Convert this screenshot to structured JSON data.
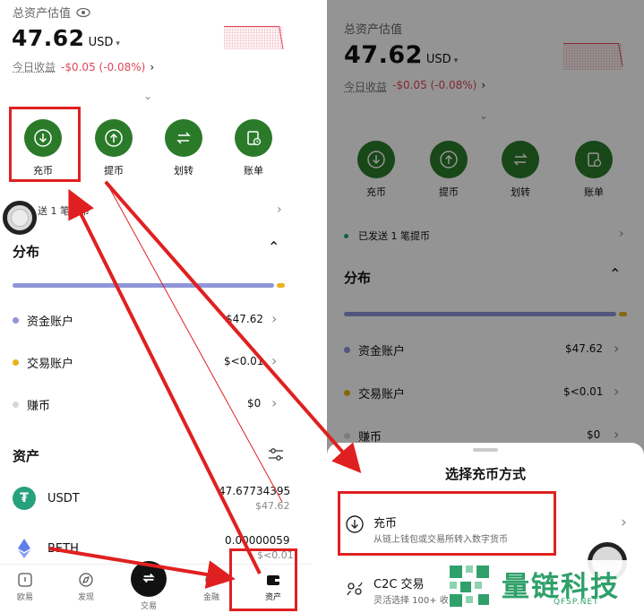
{
  "left": {
    "asset_title": "总资产估值",
    "balance": "47.62",
    "currency": "USD",
    "today_label": "今日收益",
    "today_value": "-$0.05 (-0.08%)",
    "actions": [
      {
        "label": "充币",
        "icon": "download-circle-icon"
      },
      {
        "label": "提币",
        "icon": "upload-circle-icon"
      },
      {
        "label": "划转",
        "icon": "transfer-arrows-icon"
      },
      {
        "label": "账单",
        "icon": "bill-clock-icon"
      }
    ],
    "notice": "已发送 1 笔提币",
    "notice_visible": "送 1 笔提币",
    "distribution_title": "分布",
    "accounts": [
      {
        "name": "资金账户",
        "value": "$47.62",
        "color": "#8e95d8"
      },
      {
        "name": "交易账户",
        "value": "$<0.01",
        "color": "#e8b21a"
      },
      {
        "name": "赚币",
        "value": "$0",
        "color": "#d8d8d8"
      }
    ],
    "assets_title": "资产",
    "assets": [
      {
        "symbol": "USDT",
        "amount": "47.67734395",
        "usd": "$47.62"
      },
      {
        "symbol": "BETH",
        "amount": "0.00000059",
        "usd": "$<0.01"
      }
    ],
    "nav": [
      {
        "label": "欧易",
        "icon": "home-icon"
      },
      {
        "label": "发现",
        "icon": "discover-icon"
      },
      {
        "label": "交易",
        "icon": "trade-icon"
      },
      {
        "label": "金融",
        "icon": "finance-icon"
      },
      {
        "label": "资产",
        "icon": "wallet-icon"
      }
    ]
  },
  "right": {
    "asset_title": "总资产估值",
    "balance": "47.62",
    "currency": "USD",
    "today_label": "今日收益",
    "today_value": "-$0.05 (-0.08%)",
    "actions": [
      {
        "label": "充币"
      },
      {
        "label": "提币"
      },
      {
        "label": "划转"
      },
      {
        "label": "账单"
      }
    ],
    "notice": "已发送 1 笔提币",
    "distribution_title": "分布",
    "accounts": [
      {
        "name": "资金账户",
        "value": "$47.62"
      },
      {
        "name": "交易账户",
        "value": "$<0.01"
      },
      {
        "name": "赚币",
        "value": "$0"
      }
    ],
    "sheet": {
      "title": "选择充币方式",
      "options": [
        {
          "title": "充币",
          "desc": "从链上钱包或交易所转入数字货币"
        },
        {
          "title": "C2C 交易",
          "desc": "灵活选择 100+ 收"
        }
      ]
    }
  },
  "watermark": {
    "name": "量链科技",
    "domain": "QFSP.NET"
  },
  "colors": {
    "accent_green": "#2a7a2a",
    "negative": "#e0475a",
    "highlight": "#e02020",
    "brand": "#2fa06a"
  }
}
